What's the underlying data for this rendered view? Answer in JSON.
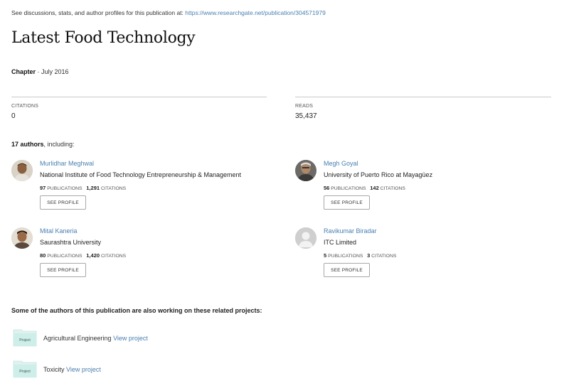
{
  "header": {
    "note": "See discussions, stats, and author profiles for this publication at: ",
    "url": "https://www.researchgate.net/publication/304571979"
  },
  "publication": {
    "title": "Latest Food Technology",
    "type": "Chapter",
    "date": " · July 2016"
  },
  "stats": {
    "citations_label": "CITATIONS",
    "citations_value": "0",
    "reads_label": "READS",
    "reads_value": "35,437"
  },
  "authors_summary": {
    "count": "17 authors",
    "suffix": ", including:"
  },
  "authors": [
    {
      "name": "Murlidhar Meghwal",
      "institution": "National Institute of Food Technology Entrepreneurship & Management",
      "publications": "97",
      "publications_label": "PUBLICATIONS",
      "citations": "1,291",
      "citations_label": "CITATIONS",
      "button": "SEE PROFILE"
    },
    {
      "name": "Megh Goyal",
      "institution": "University of Puerto Rico at Mayagüez",
      "publications": "56",
      "publications_label": "PUBLICATIONS",
      "citations": "142",
      "citations_label": "CITATIONS",
      "button": "SEE PROFILE"
    },
    {
      "name": "Mital Kaneria",
      "institution": "Saurashtra University",
      "publications": "80",
      "publications_label": "PUBLICATIONS",
      "citations": "1,420",
      "citations_label": "CITATIONS",
      "button": "SEE PROFILE"
    },
    {
      "name": "Ravikumar Biradar",
      "institution": "ITC Limited",
      "publications": "5",
      "publications_label": "PUBLICATIONS",
      "citations": "3",
      "citations_label": "CITATIONS",
      "button": "SEE PROFILE"
    }
  ],
  "projects": {
    "heading": "Some of the authors of this publication are also working on these related projects:",
    "folder_label": "Project",
    "items": [
      {
        "name": "Agricultural Engineering ",
        "link": "View project"
      },
      {
        "name": "Toxicity ",
        "link": "View project"
      }
    ]
  },
  "colors": {
    "link": "#4a7fb0",
    "folder": "#cdeee9",
    "rule": "#c8c8c8"
  }
}
